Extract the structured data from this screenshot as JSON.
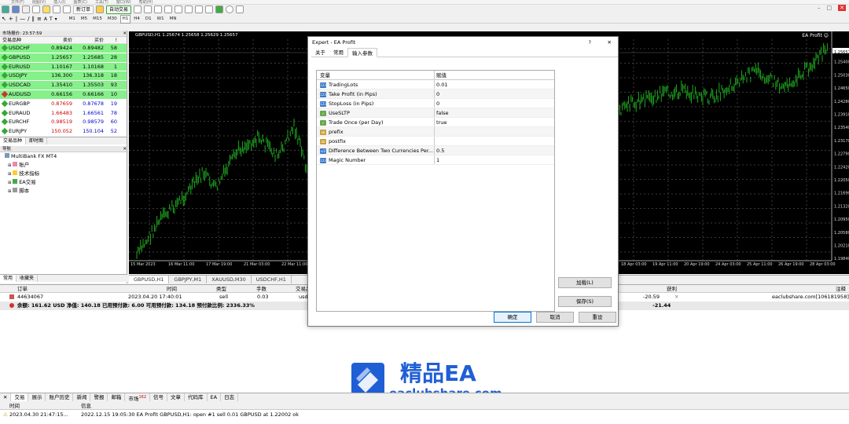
{
  "menu": {
    "items": [
      "文件(F)",
      "视图(V)",
      "插入(I)",
      "图表(C)",
      "工具(T)",
      "窗口(W)",
      "帮助(H)"
    ]
  },
  "toolbar": {
    "new_order": "新订单",
    "autotrading": "自动交易",
    "timeframes": [
      "M1",
      "M5",
      "M15",
      "M30",
      "H1",
      "H4",
      "D1",
      "W1",
      "MN"
    ],
    "active_tf": "H1"
  },
  "market_watch": {
    "title": "市场报价: 23:57:59",
    "headers": [
      "交易品种",
      "卖价",
      "买价",
      "!"
    ],
    "rows": [
      {
        "symbol": "USDCHF",
        "bid": "0.89424",
        "ask": "0.89482",
        "spread": "58"
      },
      {
        "symbol": "GBPUSD",
        "bid": "1.25657",
        "ask": "1.25685",
        "spread": "28"
      },
      {
        "symbol": "EURUSD",
        "bid": "1.10167",
        "ask": "1.10168",
        "spread": "1"
      },
      {
        "symbol": "USDJPY",
        "bid": "136.300",
        "ask": "136.318",
        "spread": "18"
      },
      {
        "symbol": "USDCAD",
        "bid": "1.35410",
        "ask": "1.35503",
        "spread": "93"
      },
      {
        "symbol": "AUDUSD",
        "bid": "0.66156",
        "ask": "0.66166",
        "spread": "10"
      },
      {
        "symbol": "EURGBP",
        "bid": "0.87659",
        "ask": "0.87678",
        "spread": "19"
      },
      {
        "symbol": "EURAUD",
        "bid": "1.66483",
        "ask": "1.66561",
        "spread": "78"
      },
      {
        "symbol": "EURCHF",
        "bid": "0.98519",
        "ask": "0.98579",
        "spread": "60"
      },
      {
        "symbol": "EURJPY",
        "bid": "150.052",
        "ask": "150.104",
        "spread": "52"
      }
    ],
    "tabs": [
      "交易品种",
      "即时图"
    ]
  },
  "navigator": {
    "title": "导航",
    "root": "MultiBank FX MT4",
    "items": [
      "账户",
      "技术指标",
      "EA交易",
      "脚本"
    ],
    "tabs": [
      "常用",
      "收藏夹"
    ]
  },
  "chart": {
    "header": "GBPUSD,H1  1.25674 1.25658 1.25629 1.25657",
    "ea_label": "EA Profit",
    "price_labels": [
      "1.25657",
      "1.25400",
      "1.25030",
      "1.24650",
      "1.24280",
      "1.23910",
      "1.23540",
      "1.23170",
      "1.22790",
      "1.22420",
      "1.22050",
      "1.21690",
      "1.21320",
      "1.20950",
      "1.20580",
      "1.20210",
      "1.19840"
    ],
    "time_left": [
      "15 Mar 2023",
      "16 Mar 11:00",
      "17 Mar 19:00",
      "21 Mar 03:00",
      "22 Mar 11:00",
      "23 Mar 19:00"
    ],
    "time_right": [
      "18 Apr 03:00",
      "19 Apr 11:00",
      "20 Apr 19:00",
      "24 Apr 03:00",
      "25 Apr 11:00",
      "26 Apr 19:00",
      "28 Apr 03:00"
    ],
    "tabs": [
      "GBPUSD,H1",
      "GBPJPY,M1",
      "XAUUSD,M30",
      "USDCHF,H1"
    ]
  },
  "terminal": {
    "headers": {
      "order": "订单",
      "time": "时间",
      "type": "类型",
      "lots": "手数",
      "symbol": "交易品",
      "profit": "获利",
      "comment": "注释"
    },
    "row": {
      "order": "44634067",
      "time": "2023.04.20 17:40:01",
      "type": "sell",
      "lots": "0.03",
      "symbol": "usd",
      "profit": "-20.59",
      "comment": "eaclubshare.com[106181958]"
    },
    "balance": "余额: 161.62 USD  净值: 140.18  已用预付款: 6.00  可用预付款: 134.18  预付款比例: 2336.33%",
    "total": "-21.44"
  },
  "bottom_tabs": [
    "交易",
    "展示",
    "账户历史",
    "新闻",
    "警报",
    "邮箱",
    "市场",
    "信号",
    "文章",
    "代码库",
    "EA",
    "日志"
  ],
  "market_badge": "162",
  "journal": {
    "headers": [
      "时间",
      "信息"
    ],
    "row_time": "2023.04.30 21:47:15...",
    "row_msg": "2022.12.15 19:05:30  EA Profit GBPUSD,H1: open #1 sell 0.01 GBPUSD at 1.22002 ok"
  },
  "dialog": {
    "title": "Expert - EA Profit",
    "help": "?",
    "tabs": [
      "关于",
      "常用",
      "输入参数"
    ],
    "grid_headers": [
      "变量",
      "赋值"
    ],
    "params": [
      {
        "name": "TradingLots",
        "value": "0.01",
        "icon": "num"
      },
      {
        "name": "Take Profit (in Pips)",
        "value": "0",
        "icon": "num"
      },
      {
        "name": "StopLoss (in Pips)",
        "value": "0",
        "icon": "num"
      },
      {
        "name": "UseSLTP",
        "value": "false",
        "icon": "bool"
      },
      {
        "name": "Trade Once (per Day)",
        "value": "true",
        "icon": "bool"
      },
      {
        "name": "prefix",
        "value": "",
        "icon": "str"
      },
      {
        "name": "postfix",
        "value": "",
        "icon": "str"
      },
      {
        "name": "Difference Between Two Currencies Per...",
        "value": "0.5",
        "icon": "dbl"
      },
      {
        "name": "Magic Number",
        "value": "1",
        "icon": "num"
      }
    ],
    "load": "加载(L)",
    "save": "保存(S)",
    "ok": "确定",
    "cancel": "取消",
    "reset": "重设"
  },
  "watermark": {
    "title": "精品EA",
    "url": "eaclubshare.com"
  },
  "colors": {
    "chart_bg": "#000000",
    "candle": "#1fa81f",
    "quote_bg": "#86f08a"
  }
}
